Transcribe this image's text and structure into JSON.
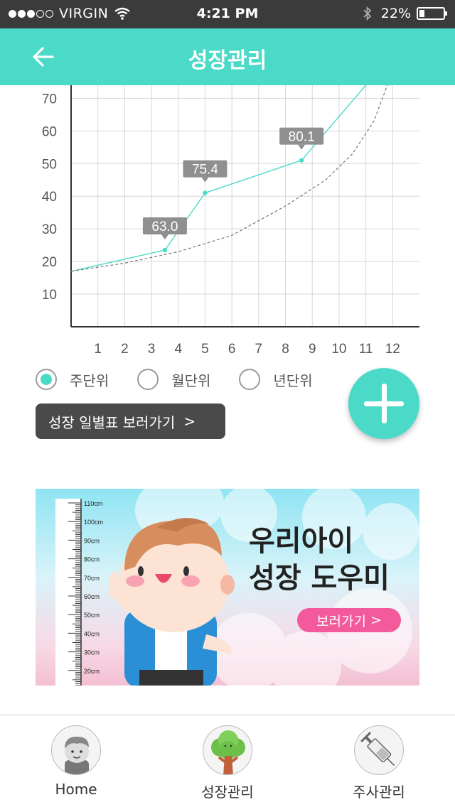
{
  "status": {
    "carrier": "VIRGIN",
    "time": "4:21 PM",
    "battery": "22%",
    "battery_level": 0.22
  },
  "header": {
    "title": "성장관리",
    "back_icon": "arrow-left-icon"
  },
  "chart_data": {
    "type": "line",
    "x_ticks": [
      1,
      2,
      3,
      4,
      5,
      6,
      7,
      8,
      9,
      10,
      11,
      12
    ],
    "y_ticks": [
      10,
      20,
      30,
      40,
      50,
      60,
      70
    ],
    "xlim": [
      0,
      13
    ],
    "ylim": [
      0,
      74
    ],
    "grid": true,
    "series": [
      {
        "style": "solid",
        "color": "#4bdac8",
        "points": [
          [
            0,
            17
          ],
          [
            3.5,
            23.5
          ],
          [
            5,
            41
          ],
          [
            8.6,
            51
          ],
          [
            11,
            74
          ]
        ]
      },
      {
        "style": "dashed",
        "color": "#777777",
        "points": [
          [
            0,
            17
          ],
          [
            2,
            19.5
          ],
          [
            4,
            23
          ],
          [
            6,
            28
          ],
          [
            8,
            37
          ],
          [
            9.5,
            45
          ],
          [
            10.5,
            53
          ],
          [
            11.3,
            63
          ],
          [
            11.8,
            74
          ]
        ]
      }
    ],
    "annotations": [
      {
        "x": 3.5,
        "y": 23.5,
        "label": "63.0"
      },
      {
        "x": 5,
        "y": 41,
        "label": "75.4"
      },
      {
        "x": 8.6,
        "y": 51,
        "label": "80.1"
      }
    ]
  },
  "period": {
    "options": [
      {
        "label": "주단위",
        "selected": true
      },
      {
        "label": "월단위",
        "selected": false
      },
      {
        "label": "년단위",
        "selected": false
      }
    ]
  },
  "table_button": {
    "label": "성장 일별표 보러가기",
    "chevron": ">"
  },
  "fab": {
    "icon": "plus-icon"
  },
  "banner": {
    "line1": "우리아이",
    "line2": "성장 도우미",
    "cta": "보러가기",
    "cta_chevron": ">",
    "ruler_labels": [
      "110cm",
      "100cm",
      "90cm",
      "80cm",
      "70cm",
      "60cm",
      "50cm",
      "40cm",
      "30cm",
      "20cm"
    ]
  },
  "tabs": [
    {
      "label": "Home",
      "icon": "boy-avatar-icon"
    },
    {
      "label": "성장관리",
      "icon": "tree-icon"
    },
    {
      "label": "주사관리",
      "icon": "syringe-icon"
    }
  ],
  "colors": {
    "accent": "#4bdac8",
    "dark_button": "#4a4a4a",
    "pink": "#f35a9b"
  }
}
